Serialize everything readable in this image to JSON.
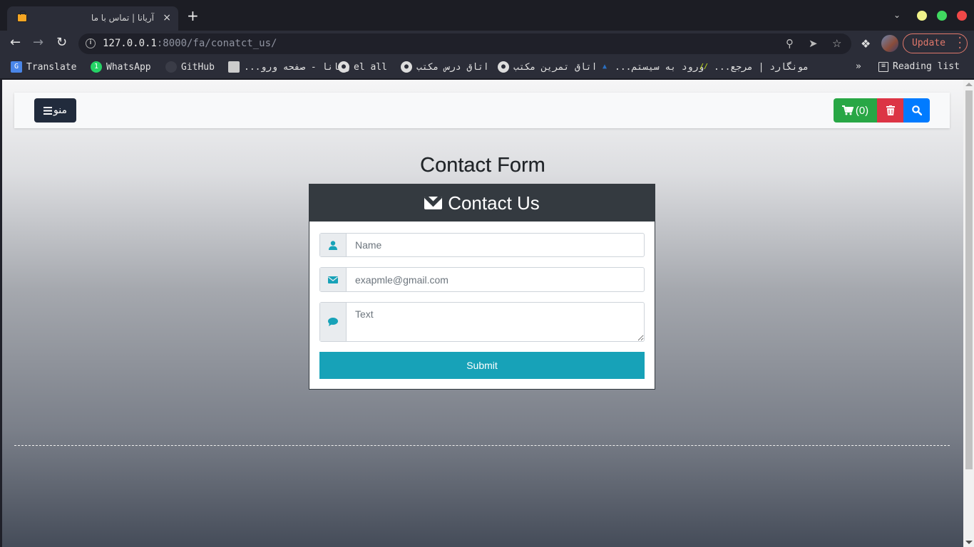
{
  "browser": {
    "tab": {
      "title": "آریانا | تماس با ما",
      "close": "×"
    },
    "new_tab": "+",
    "tab_menu": "⌄",
    "window_controls": {
      "minimize_color": "#f4f48a",
      "maximize_color": "#4ade63",
      "close_color": "#f24b4b"
    },
    "nav": {
      "back": "←",
      "forward": "→",
      "reload": "↻"
    },
    "url": {
      "host": "127.0.0.1",
      "rest": ":8000/fa/conatct_us/"
    },
    "omnibox_icons": [
      "zoom-icon",
      "send-icon",
      "star-icon"
    ],
    "update_label": "Update",
    "bookmarks": [
      {
        "label": "Translate",
        "icon": "google-translate-icon"
      },
      {
        "label": "WhatsApp",
        "icon": "whatsapp-icon"
      },
      {
        "label": "GitHub",
        "icon": "github-icon"
      },
      {
        "label": "ویانا - صفحه ورو...",
        "icon": "page-icon"
      },
      {
        "label": "el all",
        "icon": "user-circle-icon"
      },
      {
        "label": "اتاق درس مکتب",
        "icon": "user-circle-icon"
      },
      {
        "label": "اتاق تمرین مکتب",
        "icon": "user-circle-icon"
      },
      {
        "label": "ورود به سیستم...",
        "icon": "logo-icon"
      },
      {
        "label": "مونگارد | مرجع...",
        "icon": "stripes-icon"
      }
    ],
    "overflow": "»",
    "reading_list": "Reading list"
  },
  "page": {
    "menu_button": "منو",
    "cart_label": "(0)",
    "colors": {
      "cart": "#28a745",
      "delete": "#dc3545",
      "search": "#007bff",
      "accent": "#17a2b8",
      "card_header": "#343a40"
    },
    "form_title": "Contact Form",
    "card_title": "Contact Us",
    "fields": {
      "name_placeholder": "Name",
      "email_placeholder": "exapmle@gmail.com",
      "text_placeholder": "Text"
    },
    "submit_label": "Submit"
  }
}
